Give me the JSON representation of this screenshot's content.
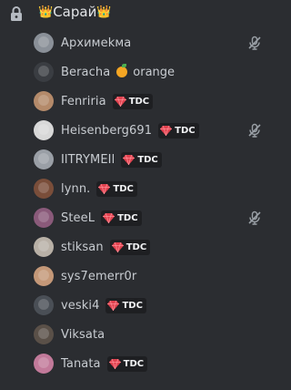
{
  "channel": {
    "name": "Сарай",
    "crown": "👑",
    "lock_icon": "lock-icon"
  },
  "members": [
    {
      "name": "Арxимekма",
      "avatar_color": "#8a9098",
      "muted": true,
      "tag": null,
      "status_text": null
    },
    {
      "name": "Beracha",
      "avatar_color": "#3a3d42",
      "muted": false,
      "tag": null,
      "status_text": "orange"
    },
    {
      "name": "Fenriria",
      "avatar_color": "#b48a6a",
      "muted": false,
      "tag": "TDC",
      "status_text": null
    },
    {
      "name": "Heisenberg691",
      "avatar_color": "#d8d8d8",
      "muted": true,
      "tag": "TDC",
      "status_text": null
    },
    {
      "name": "IlTRYMEIl",
      "avatar_color": "#9a9fa6",
      "muted": false,
      "tag": "TDC",
      "status_text": null
    },
    {
      "name": "lynn.",
      "avatar_color": "#7a4e3a",
      "muted": false,
      "tag": "TDC",
      "status_text": null
    },
    {
      "name": "SteeL",
      "avatar_color": "#8a5a7a",
      "muted": true,
      "tag": "TDC",
      "status_text": null
    },
    {
      "name": "stiksan",
      "avatar_color": "#b8b0a6",
      "muted": false,
      "tag": "TDC",
      "status_text": null
    },
    {
      "name": "sys7emerr0r",
      "avatar_color": "#c49878",
      "muted": false,
      "tag": null,
      "status_text": null
    },
    {
      "name": "veski4",
      "avatar_color": "#4a4f56",
      "muted": false,
      "tag": "TDC",
      "status_text": null
    },
    {
      "name": "Viksata",
      "avatar_color": "#5a5048",
      "muted": false,
      "tag": null,
      "status_text": null
    },
    {
      "name": "Tanata",
      "avatar_color": "#c27a9a",
      "muted": false,
      "tag": "TDC",
      "status_text": null
    }
  ],
  "colors": {
    "background": "#2b2d31",
    "text": "#c8ccd1",
    "tag_bg": "#1e1f22",
    "gem": "#e0424f",
    "orange": "#f5a623"
  }
}
